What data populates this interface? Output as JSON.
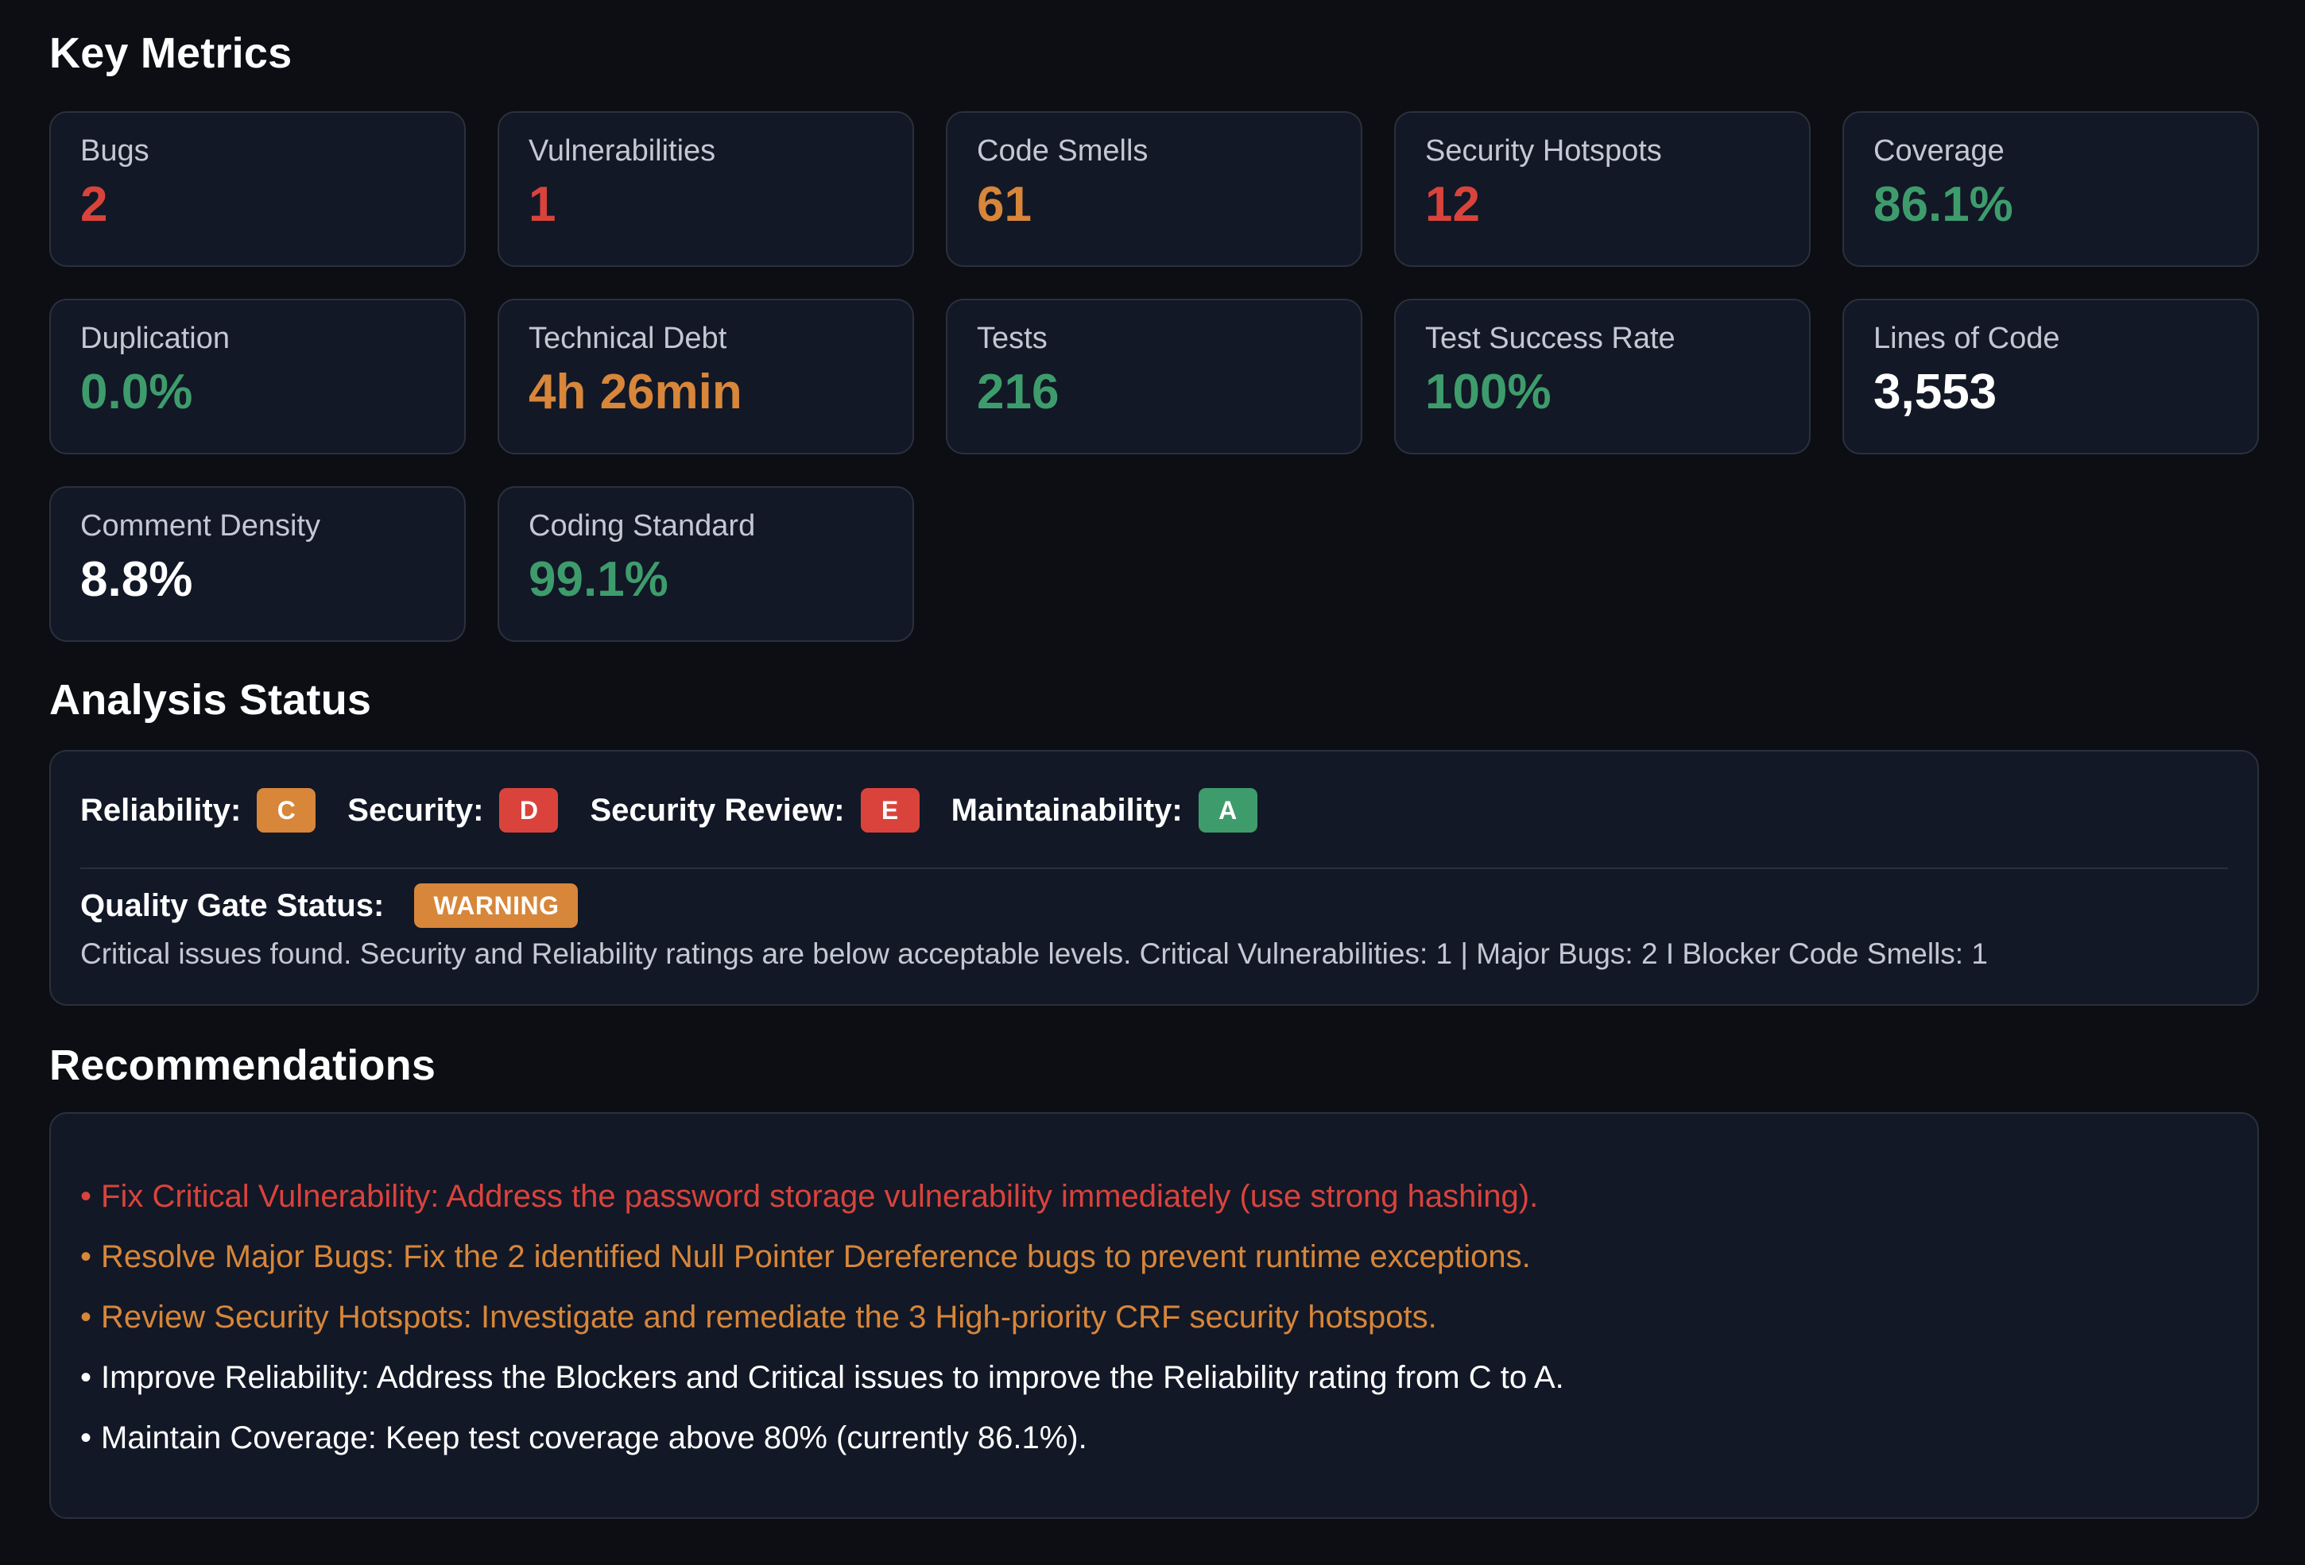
{
  "sections": {
    "key_metrics": "Key Metrics",
    "analysis_status": "Analysis Status",
    "recommendations": "Recommendations"
  },
  "colors": {
    "red": "#d9433c",
    "orange": "#d7863a",
    "green": "#3e9c6c",
    "white": "#ffffff"
  },
  "metrics": [
    {
      "label": "Bugs",
      "value": "2",
      "color": "#d9433c"
    },
    {
      "label": "Vulnerabilities",
      "value": "1",
      "color": "#d9433c"
    },
    {
      "label": "Code Smells",
      "value": "61",
      "color": "#d7863a"
    },
    {
      "label": "Security Hotspots",
      "value": "12",
      "color": "#d9433c"
    },
    {
      "label": "Coverage",
      "value": "86.1%",
      "color": "#3e9c6c"
    },
    {
      "label": "Duplication",
      "value": "0.0%",
      "color": "#3e9c6c"
    },
    {
      "label": "Technical Debt",
      "value": "4h 26min",
      "color": "#d7863a"
    },
    {
      "label": "Tests",
      "value": "216",
      "color": "#3e9c6c"
    },
    {
      "label": "Test Success Rate",
      "value": "100%",
      "color": "#3e9c6c"
    },
    {
      "label": "Lines of Code",
      "value": "3,553",
      "color": "#ffffff"
    },
    {
      "label": "Comment Density",
      "value": "8.8%",
      "color": "#ffffff"
    },
    {
      "label": "Coding Standard",
      "value": "99.1%",
      "color": "#3e9c6c"
    }
  ],
  "analysis": {
    "ratings": [
      {
        "label": "Reliability:",
        "grade": "C",
        "color": "#d7863a"
      },
      {
        "label": "Security:",
        "grade": "D",
        "color": "#d9433c"
      },
      {
        "label": "Security Review:",
        "grade": "E",
        "color": "#d9433c"
      },
      {
        "label": "Maintainability:",
        "grade": "A",
        "color": "#3e9c6c"
      }
    ],
    "gate_label": "Quality Gate Status:",
    "gate_status": "WARNING",
    "gate_color": "#d7863a",
    "gate_description": "Critical issues found. Security and Reliability ratings are below acceptable levels. Critical Vulnerabilities: 1 | Major Bugs: 2 I Blocker Code Smells: 1"
  },
  "recommendations": [
    {
      "text": "Fix Critical Vulnerability: Address the password storage vulnerability immediately (use strong hashing).",
      "color": "#d9433c"
    },
    {
      "text": "Resolve Major Bugs: Fix the 2 identified Null Pointer Dereference bugs to prevent runtime exceptions.",
      "color": "#d7863a"
    },
    {
      "text": "Review Security Hotspots: Investigate and remediate the 3 High-priority CRF security hotspots.",
      "color": "#d7863a"
    },
    {
      "text": "Improve Reliability: Address the Blockers and Critical issues to improve the Reliability rating from C to A.",
      "color": "#ffffff"
    },
    {
      "text": "Maintain Coverage: Keep test coverage above 80% (currently 86.1%).",
      "color": "#ffffff"
    }
  ]
}
